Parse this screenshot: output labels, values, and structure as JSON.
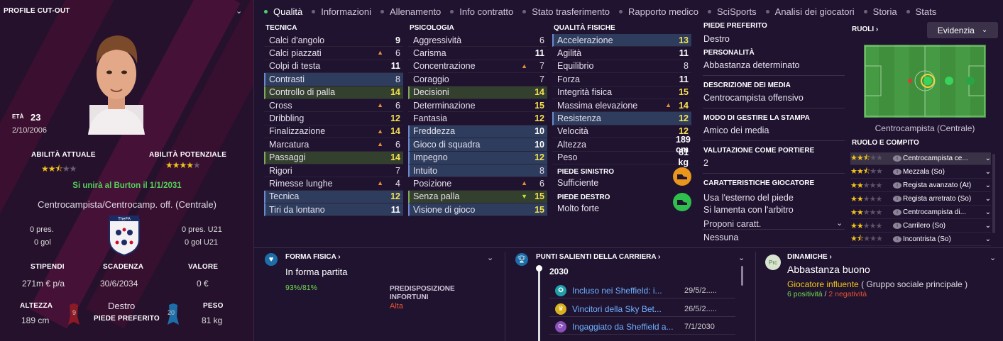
{
  "profile": {
    "header": "PROFILE CUT-OUT",
    "age_label": "ETÀ",
    "age": "23",
    "dob": "2/10/2006",
    "current_ability_label": "ABILITÀ ATTUALE",
    "potential_ability_label": "ABILITÀ POTENZIALE",
    "current_ability_stars": 2.5,
    "potential_ability_stars": 4,
    "transfer_note": "Si unirà al Burton il 1/1/2031",
    "position": "Centrocampista/Centrocamp. off. (Centrale)",
    "caps": "0 pres.",
    "goals": "0 gol",
    "u21_caps": "0 pres. U21",
    "u21_goals": "0 gol U21",
    "badge_text": "TheFA",
    "wage_label": "STIPENDI",
    "wage": "271m € p/a",
    "contract_label": "SCADENZA",
    "contract": "30/6/2034",
    "value_label": "VALORE",
    "value": "0 €",
    "height_label": "ALTEZZA",
    "height": "189 cm",
    "foot": "Destro",
    "foot_label": "PIEDE PREFERITO",
    "left_number": "9",
    "right_number": "20",
    "weight_label": "PESO",
    "weight": "81 kg"
  },
  "tabs": [
    "Qualità",
    "Informazioni",
    "Allenamento",
    "Info contratto",
    "Stato trasferimento",
    "Rapporto medico",
    "SciSports",
    "Analisi dei giocatori",
    "Storia",
    "Stats"
  ],
  "technical": {
    "title": "TECNICA",
    "rows": [
      {
        "name": "Calci d'angolo",
        "value": "9"
      },
      {
        "name": "Calci piazzati",
        "value": "6"
      },
      {
        "name": "Colpi di testa",
        "value": "11"
      },
      {
        "name": "Contrasti",
        "value": "8"
      },
      {
        "name": "Controllo di palla",
        "value": "14"
      },
      {
        "name": "Cross",
        "value": "6"
      },
      {
        "name": "Dribbling",
        "value": "12"
      },
      {
        "name": "Finalizzazione",
        "value": "14"
      },
      {
        "name": "Marcatura",
        "value": "6"
      },
      {
        "name": "Passaggi",
        "value": "14"
      },
      {
        "name": "Rigori",
        "value": "7"
      },
      {
        "name": "Rimesse lunghe",
        "value": "4"
      },
      {
        "name": "Tecnica",
        "value": "12"
      },
      {
        "name": "Tiri da lontano",
        "value": "11"
      }
    ]
  },
  "mental": {
    "title": "PSICOLOGIA",
    "rows": [
      {
        "name": "Aggressività",
        "value": "6"
      },
      {
        "name": "Carisma",
        "value": "11"
      },
      {
        "name": "Concentrazione",
        "value": "7"
      },
      {
        "name": "Coraggio",
        "value": "7"
      },
      {
        "name": "Decisioni",
        "value": "14"
      },
      {
        "name": "Determinazione",
        "value": "15"
      },
      {
        "name": "Fantasia",
        "value": "12"
      },
      {
        "name": "Freddezza",
        "value": "10"
      },
      {
        "name": "Gioco di squadra",
        "value": "10"
      },
      {
        "name": "Impegno",
        "value": "12"
      },
      {
        "name": "Intuito",
        "value": "8"
      },
      {
        "name": "Posizione",
        "value": "6"
      },
      {
        "name": "Senza palla",
        "value": "15"
      },
      {
        "name": "Visione di gioco",
        "value": "15"
      }
    ]
  },
  "physical": {
    "title": "QUALITÀ FISICHE",
    "rows": [
      {
        "name": "Accelerazione",
        "value": "13"
      },
      {
        "name": "Agilità",
        "value": "11"
      },
      {
        "name": "Equilibrio",
        "value": "8"
      },
      {
        "name": "Forza",
        "value": "11"
      },
      {
        "name": "Integrità fisica",
        "value": "15"
      },
      {
        "name": "Massima elevazione",
        "value": "14"
      },
      {
        "name": "Resistenza",
        "value": "12"
      },
      {
        "name": "Velocità",
        "value": "12"
      },
      {
        "name": "Altezza",
        "value": "189 cm"
      },
      {
        "name": "Peso",
        "value": "81 kg"
      }
    ],
    "left_foot_label": "PIEDE SINISTRO",
    "left_foot": "Sufficiente",
    "right_foot_label": "PIEDE DESTRO",
    "right_foot": "Molto forte"
  },
  "info": {
    "foot_label": "PIEDE PREFERITO",
    "foot": "Destro",
    "personality_label": "PERSONALITÀ",
    "personality": "Abbastanza determinato",
    "media_label": "DESCRIZIONE DEI MEDIA",
    "media": "Centrocampista offensivo",
    "press_label": "MODO DI GESTIRE LA STAMPA",
    "press": "Amico dei media",
    "gk_label": "VALUTAZIONE COME PORTIERE",
    "gk": "2",
    "traits_label": "CARATTERISTICHE GIOCATORE",
    "traits": [
      "Usa l'esterno del piede",
      "Si lamenta con l'arbitro"
    ],
    "propose": "Proponi caratt.",
    "none": "Nessuna"
  },
  "roles": {
    "title": "RUOLI",
    "dropdown": "Evidenzia",
    "pitch_caption": "Centrocampista (Centrale)",
    "role_title": "RUOLO E COMPITO",
    "items": [
      {
        "label": "Centrocampista ce...",
        "stars": 2.5
      },
      {
        "label": "Mezzala (So)",
        "stars": 2.5
      },
      {
        "label": "Regista avanzato (At)",
        "stars": 2
      },
      {
        "label": "Regista arretrato (So)",
        "stars": 2
      },
      {
        "label": "Centrocampista di...",
        "stars": 2
      },
      {
        "label": "Carrilero (So)",
        "stars": 2
      },
      {
        "label": "Incontrista (So)",
        "stars": 1.5
      }
    ]
  },
  "fitness": {
    "title": "FORMA FISICA",
    "status": "In forma partita",
    "pct1": "93%",
    "sep": "/",
    "pct2": "81%",
    "injury_label_1": "PREDISPOSIZIONE",
    "injury_label_2": "INFORTUNI",
    "injury": "Alta"
  },
  "career": {
    "title": "PUNTI SALIENTI DELLA CARRIERA",
    "year": "2030",
    "items": [
      {
        "text": "Incluso nei Sheffield: i...",
        "date": "29/5/2....."
      },
      {
        "text": "Vincitori della Sky Bet...",
        "date": "26/5/2....."
      },
      {
        "text": "Ingaggiato da Sheffield a...",
        "date": "7/1/2030"
      }
    ]
  },
  "dynamics": {
    "title": "DINAMICHE",
    "icon_text": "Prc",
    "status": "Abbastanza buono",
    "influence": "Giocatore influente",
    "group": "( Gruppo sociale principale )",
    "positives": "6 positività",
    "slash": "/",
    "negatives": "2 negatività"
  },
  "colors": {
    "accent_yellow": "#f7e34f",
    "green": "#4cd46c",
    "blue_highlight": "#2e3d5e",
    "link": "#6fb1ff"
  }
}
